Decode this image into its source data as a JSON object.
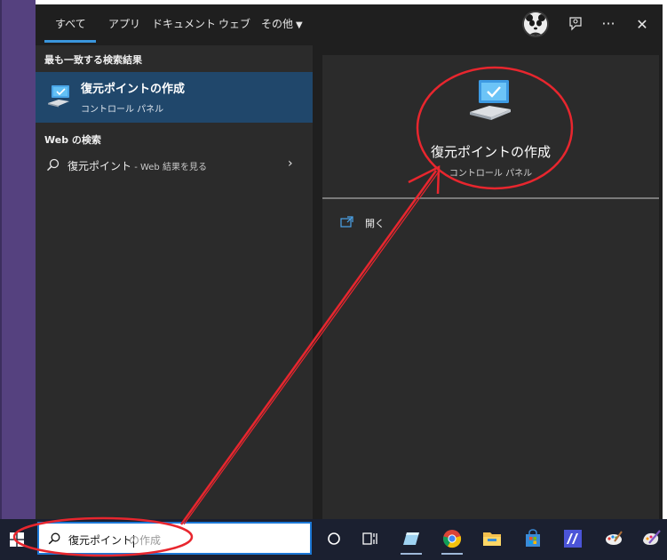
{
  "tabs": [
    {
      "label": "すべて"
    },
    {
      "label": "アプリ"
    },
    {
      "label": "ドキュメント"
    },
    {
      "label": "ウェブ"
    },
    {
      "label": "その他"
    }
  ],
  "topbar_icons": [
    "avatar",
    "feedback-icon",
    "more-icon",
    "close-icon"
  ],
  "more_label": "···",
  "close_label": "✕",
  "best_match": {
    "heading": "最も一致する検索結果",
    "title": "復元ポイントの作成",
    "subtitle": "コントロール パネル"
  },
  "web_search": {
    "heading": "Web の検索",
    "query": "復元ポイント",
    "suffix": " - Web 結果を見る",
    "chevron": "›"
  },
  "detail": {
    "title": "復元ポイントの作成",
    "subtitle": "コントロール パネル",
    "action_open": "開く"
  },
  "taskbar": {
    "search_value": "復元ポイント",
    "search_ghost": "の作成",
    "apps": [
      "cortana-icon",
      "task-view-icon",
      "files-app-icon",
      "chrome-icon",
      "file-explorer-icon",
      "store-icon",
      "app-icon",
      "paint-icon",
      "paint3d-icon"
    ]
  },
  "colors": {
    "selected_row": "#20476b",
    "accent": "#3a96dd",
    "annotation": "#e8262e"
  }
}
